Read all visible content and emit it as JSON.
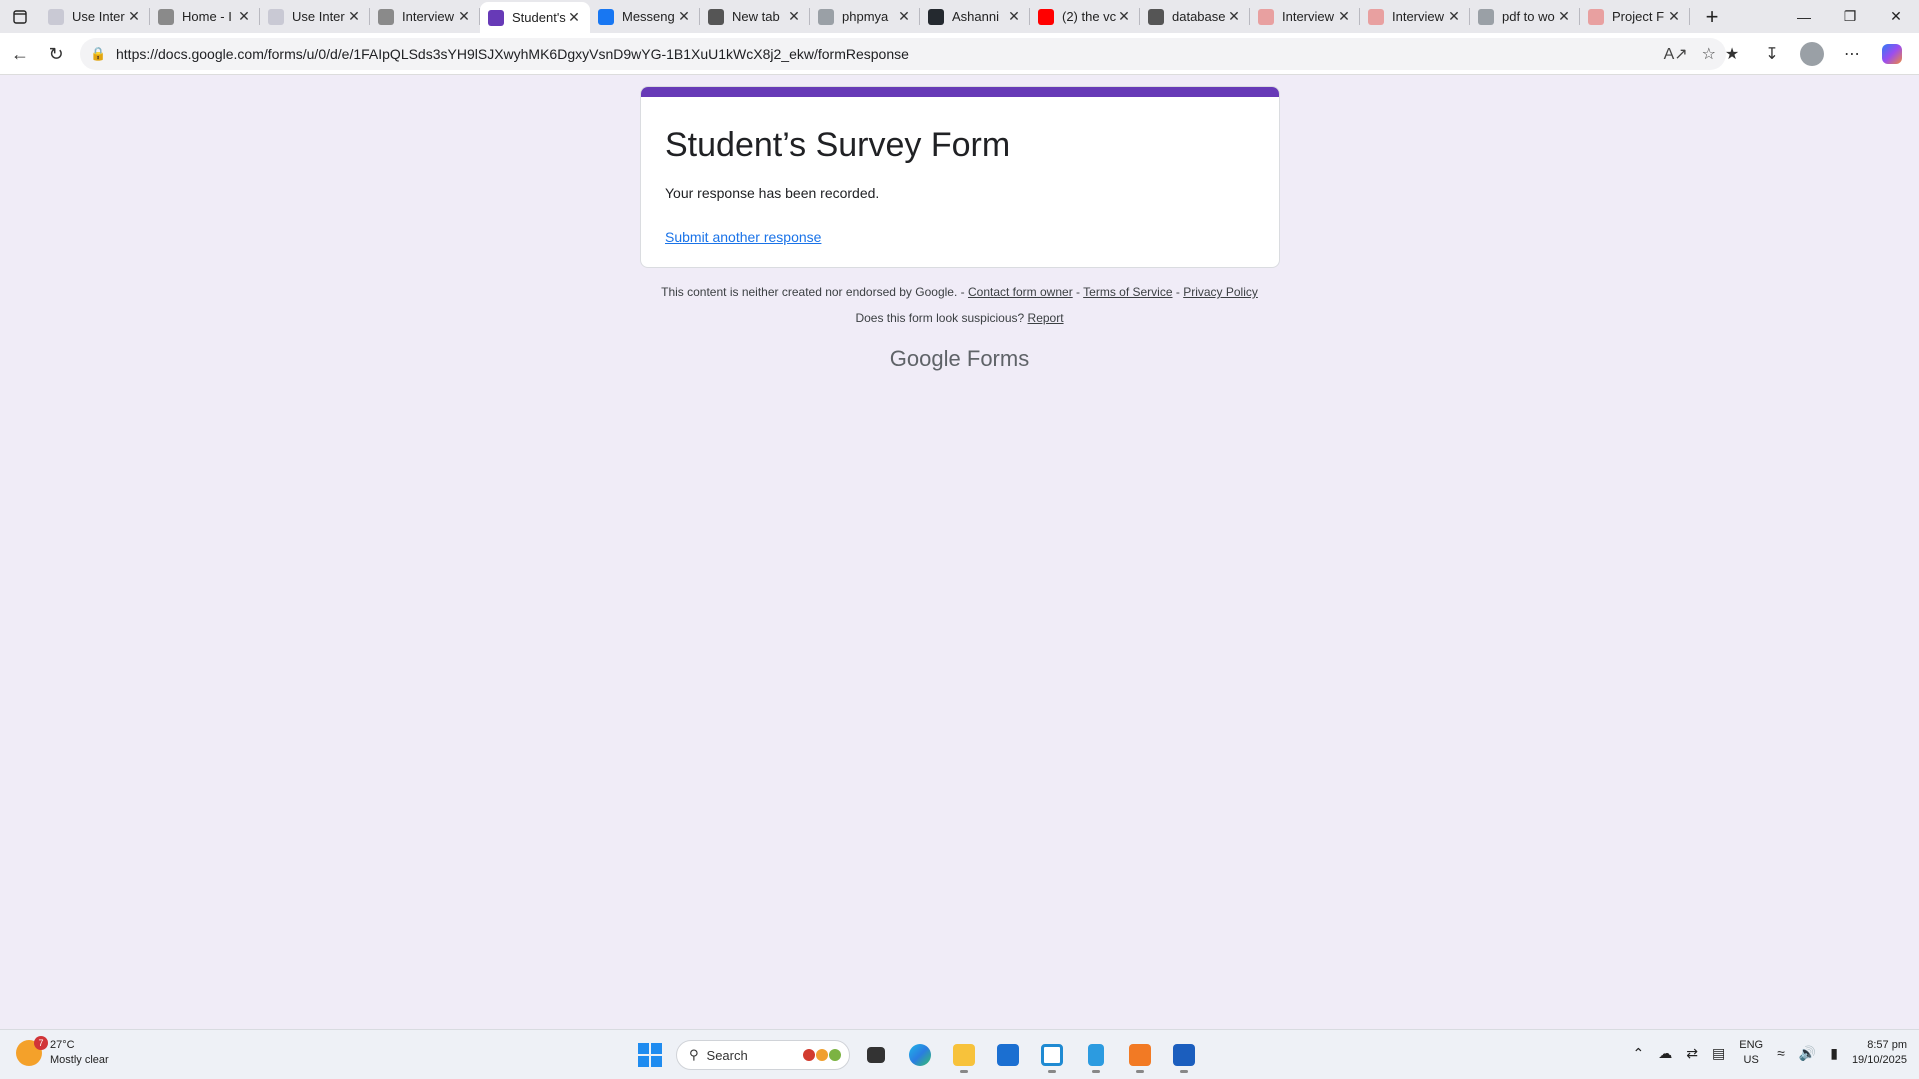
{
  "browser": {
    "tabs": [
      {
        "title": "Use Inter",
        "favicon": "uc-icon",
        "color": "#c9c9d4",
        "active": false
      },
      {
        "title": "Home - I",
        "favicon": "globe-icon",
        "color": "#8a8a8a",
        "active": false
      },
      {
        "title": "Use Inter",
        "favicon": "uc-icon",
        "color": "#c9c9d4",
        "active": false
      },
      {
        "title": "Interview",
        "favicon": "globe-icon",
        "color": "#8a8a8a",
        "active": false
      },
      {
        "title": "Student's",
        "favicon": "forms-icon",
        "color": "#673ab7",
        "active": true
      },
      {
        "title": "Messeng",
        "favicon": "facebook-icon",
        "color": "#1877f2",
        "active": false
      },
      {
        "title": "New tab",
        "favicon": "loading-icon",
        "color": "#555555",
        "active": false
      },
      {
        "title": "phpmya",
        "favicon": "search-icon",
        "color": "#9aa0a6",
        "active": false
      },
      {
        "title": "Ashanni",
        "favicon": "github-icon",
        "color": "#24292f",
        "active": false
      },
      {
        "title": "(2) the vc",
        "favicon": "youtube-icon",
        "color": "#ff0000",
        "active": false
      },
      {
        "title": "database",
        "favicon": "loading-icon",
        "color": "#555555",
        "active": false
      },
      {
        "title": "Interview",
        "favicon": "pdf-icon",
        "color": "#e8a0a0",
        "active": false
      },
      {
        "title": "Interview",
        "favicon": "pdf-icon",
        "color": "#e8a0a0",
        "active": false
      },
      {
        "title": "pdf to wo",
        "favicon": "search-icon",
        "color": "#9aa0a6",
        "active": false
      },
      {
        "title": "Project F",
        "favicon": "pdf-icon",
        "color": "#e8a0a0",
        "active": false
      }
    ],
    "url": "https://docs.google.com/forms/u/0/d/e/1FAIpQLSds3sYH9lSJXwyhMK6DgxyVsnD9wYG-1B1XuU1kWcX8j2_ekw/formResponse"
  },
  "form": {
    "title": "Student’s Survey Form",
    "confirmation": "Your response has been recorded.",
    "submit_another": "Submit another response",
    "accent_color": "#673ab7"
  },
  "footer": {
    "disclaimer": "This content is neither created nor endorsed by Google.",
    "sep1": " - ",
    "contact": "Contact form owner",
    "sep2": " - ",
    "terms": "Terms of Service",
    "sep3": " - ",
    "privacy": "Privacy Policy",
    "suspicious": "Does this form look suspicious?",
    "report": "Report",
    "brand_google": "Google",
    "brand_forms": "Forms"
  },
  "taskbar": {
    "weather_temp": "27°C",
    "weather_desc": "Mostly clear",
    "weather_badge": "7",
    "search_placeholder": "Search",
    "lang_top": "ENG",
    "lang_bottom": "US",
    "time": "8:57 pm",
    "date": "19/10/2025"
  }
}
